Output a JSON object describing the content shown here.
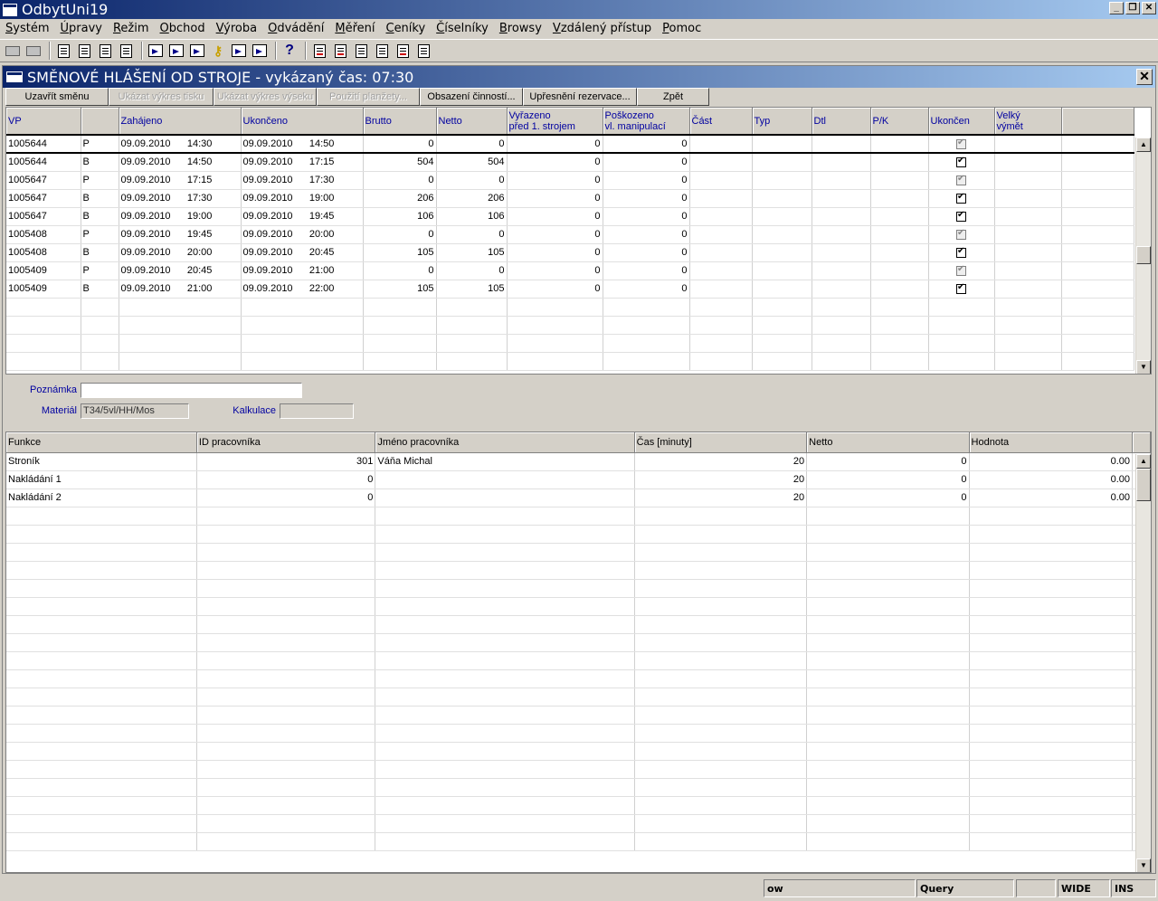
{
  "app": {
    "title": "OdbytUni19"
  },
  "menu": [
    "Systém",
    "Úpravy",
    "Režim",
    "Obchod",
    "Výroba",
    "Odvádění",
    "Měření",
    "Ceníky",
    "Číselníky",
    "Browsy",
    "Vzdálený přístup",
    "Pomoc"
  ],
  "child": {
    "title": "SMĚNOVÉ HLÁŠENÍ OD STROJE - vykázaný čas: 07:30",
    "buttons": [
      {
        "label": "Uzavřít směnu",
        "enabled": true
      },
      {
        "label": "Ukázat výkres tisku",
        "enabled": false
      },
      {
        "label": "Ukázat výkres výseku",
        "enabled": false
      },
      {
        "label": "Použití planžety...",
        "enabled": false
      },
      {
        "label": "Obsazení činností...",
        "enabled": true
      },
      {
        "label": "Upřesnění rezervace...",
        "enabled": true
      },
      {
        "label": "Zpět",
        "enabled": true
      }
    ]
  },
  "grid1": {
    "headers": [
      "VP",
      "",
      "Zahájeno",
      "Ukončeno",
      "Brutto",
      "Netto",
      "Vyřazeno\npřed 1. strojem",
      "Poškozeno\nvl. manipulací",
      "Část",
      "Typ",
      "Dtl",
      "P/K",
      "Ukončen",
      "Velký\nvýmět"
    ],
    "rows": [
      {
        "vp": "1005644",
        "t": "P",
        "start": "09.09.2010      14:30",
        "end": "09.09.2010      14:50",
        "brutto": "0",
        "netto": "0",
        "vyr": "0",
        "posk": "0",
        "done": "grey"
      },
      {
        "vp": "1005644",
        "t": "B",
        "start": "09.09.2010      14:50",
        "end": "09.09.2010      17:15",
        "brutto": "504",
        "netto": "504",
        "vyr": "0",
        "posk": "0",
        "done": "on"
      },
      {
        "vp": "1005647",
        "t": "P",
        "start": "09.09.2010      17:15",
        "end": "09.09.2010      17:30",
        "brutto": "0",
        "netto": "0",
        "vyr": "0",
        "posk": "0",
        "done": "grey"
      },
      {
        "vp": "1005647",
        "t": "B",
        "start": "09.09.2010      17:30",
        "end": "09.09.2010      19:00",
        "brutto": "206",
        "netto": "206",
        "vyr": "0",
        "posk": "0",
        "done": "on"
      },
      {
        "vp": "1005647",
        "t": "B",
        "start": "09.09.2010      19:00",
        "end": "09.09.2010      19:45",
        "brutto": "106",
        "netto": "106",
        "vyr": "0",
        "posk": "0",
        "done": "on"
      },
      {
        "vp": "1005408",
        "t": "P",
        "start": "09.09.2010      19:45",
        "end": "09.09.2010      20:00",
        "brutto": "0",
        "netto": "0",
        "vyr": "0",
        "posk": "0",
        "done": "grey"
      },
      {
        "vp": "1005408",
        "t": "B",
        "start": "09.09.2010      20:00",
        "end": "09.09.2010      20:45",
        "brutto": "105",
        "netto": "105",
        "vyr": "0",
        "posk": "0",
        "done": "on"
      },
      {
        "vp": "1005409",
        "t": "P",
        "start": "09.09.2010      20:45",
        "end": "09.09.2010      21:00",
        "brutto": "0",
        "netto": "0",
        "vyr": "0",
        "posk": "0",
        "done": "grey"
      },
      {
        "vp": "1005409",
        "t": "B",
        "start": "09.09.2010      21:00",
        "end": "09.09.2010      22:00",
        "brutto": "105",
        "netto": "105",
        "vyr": "0",
        "posk": "0",
        "done": "on"
      }
    ],
    "empty_rows": 4
  },
  "form": {
    "note_label": "Poznámka",
    "note_value": "",
    "material_label": "Materiál",
    "material_value": "T34/5vl/HH/Mos",
    "calc_label": "Kalkulace",
    "calc_value": ""
  },
  "grid2": {
    "headers": [
      "Funkce",
      "ID pracovníka",
      "Jméno pracovníka",
      "Čas [minuty]",
      "Netto",
      "Hodnota"
    ],
    "rows": [
      {
        "fn": "Stroník",
        "id": "301",
        "name": "Váňa Michal",
        "time": "20",
        "netto": "0",
        "val": "0.00"
      },
      {
        "fn": "Nakládání 1",
        "id": "0",
        "name": "",
        "time": "20",
        "netto": "0",
        "val": "0.00"
      },
      {
        "fn": "Nakládání 2",
        "id": "0",
        "name": "",
        "time": "20",
        "netto": "0",
        "val": "0.00"
      }
    ],
    "empty_rows": 19
  },
  "status": {
    "mode": "ow",
    "state": "Query",
    "wide": "WIDE",
    "ins": "INS"
  }
}
